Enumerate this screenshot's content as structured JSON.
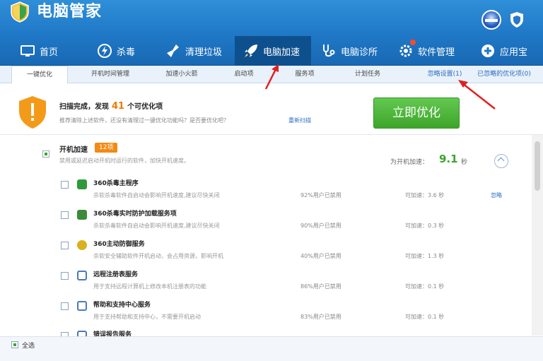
{
  "app": {
    "title": "电脑管家"
  },
  "nav": {
    "items": [
      {
        "label": "首页",
        "icon": "monitor-icon"
      },
      {
        "label": "杀毒",
        "icon": "lightning-icon"
      },
      {
        "label": "清理垃圾",
        "icon": "broom-icon"
      },
      {
        "label": "电脑加速",
        "icon": "rocket-icon",
        "active": true
      },
      {
        "label": "电脑诊所",
        "icon": "stethoscope-icon"
      },
      {
        "label": "软件管理",
        "icon": "gear-icon",
        "badge": "1"
      },
      {
        "label": "应用宝",
        "icon": "plus-circle-icon"
      }
    ]
  },
  "subtabs": {
    "items": [
      "一键优化",
      "开机时间管理",
      "加速小火箭",
      "启动项",
      "服务项",
      "计划任务"
    ],
    "links": [
      "忽略设置(1)",
      "已忽略的优化项(0)"
    ]
  },
  "banner": {
    "scan_prefix": "扫描完成，发现",
    "scan_count": "41",
    "scan_suffix": "个可优化项",
    "description": "推荐清除上述软件，还没有清理过一键优化功能吗？是否要优化吧？",
    "rescan": "重新扫描",
    "optimize_button": "立即优化"
  },
  "group": {
    "title": "开机加速",
    "tag": "12项",
    "description": "禁用或延迟启动开机时运行的软件，加快开机速度。",
    "expect_label": "为开机加速：",
    "expect_value": "9.1",
    "expect_unit": "秒"
  },
  "rows": [
    {
      "name": "360杀毒主程序",
      "desc": "杀软杀毒软件自启动会影响开机速度,建议尽快关闭",
      "users": "92%用户已禁用",
      "speed": "可加速：3.6 秒",
      "ignore": "忽略",
      "icon_color": "#2f9a3a"
    },
    {
      "name": "360杀毒实时防护加载服务项",
      "desc": "杀软杀毒软件自启动会影响开机速度,建议尽快关闭",
      "users": "90%用户已禁用",
      "speed": "可加速：0.3 秒",
      "ignore": "",
      "icon_color": "#3a8c3a"
    },
    {
      "name": "360主动防御服务",
      "desc": "杀软安全辅助软件开机启动，会占用资源，影响开机",
      "users": "40%用户已禁用",
      "speed": "可加速：1.3 秒",
      "ignore": "",
      "icon_color": "#d8b020"
    },
    {
      "name": "远程注册表服务",
      "desc": "用于支持远程计算机上修改本机注册表的功能",
      "users": "86%用户已禁用",
      "speed": "可加速：0.1 秒",
      "ignore": "",
      "icon_color": "#4a7ab8"
    },
    {
      "name": "帮助和支持中心服务",
      "desc": "用于支持帮助和支持中心，不需要开机启动",
      "users": "83%用户已禁用",
      "speed": "可加速：0.1 秒",
      "ignore": "",
      "icon_color": "#4a7ab8"
    },
    {
      "name": "错误报告服务",
      "desc": "",
      "users": "",
      "speed": "",
      "ignore": "",
      "icon_color": "#4a7ab8"
    }
  ],
  "footer": {
    "select_all": "全选"
  }
}
